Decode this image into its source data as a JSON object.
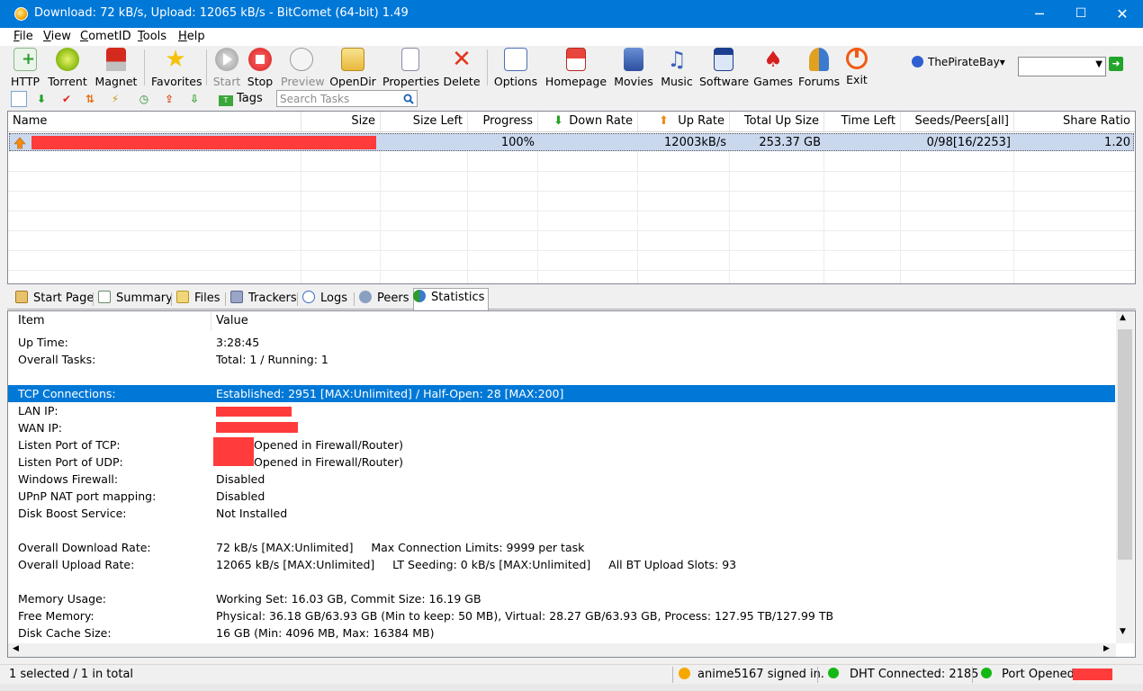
{
  "window": {
    "title": "Download: 72 kB/s, Upload: 12065 kB/s - BitComet (64-bit) 1.49",
    "minimize": "─",
    "maximize": "☐",
    "close": "✕"
  },
  "menu": [
    {
      "label": "File",
      "underline": "F",
      "rest": "ile"
    },
    {
      "label": "View",
      "underline": "V",
      "rest": "iew"
    },
    {
      "label": "CometID",
      "underline": "C",
      "rest": "ometID"
    },
    {
      "label": "Tools",
      "underline": "T",
      "rest": "ools"
    },
    {
      "label": "Help",
      "underline": "H",
      "rest": "elp"
    }
  ],
  "toolbar": {
    "http": "HTTP",
    "torrent": "Torrent",
    "magnet": "Magnet",
    "favorites": "Favorites",
    "start": "Start",
    "stop": "Stop",
    "preview": "Preview",
    "opendir": "OpenDir",
    "properties": "Properties",
    "delete": "Delete",
    "options": "Options",
    "homepage": "Homepage",
    "movies": "Movies",
    "music": "Music",
    "software": "Software",
    "games": "Games",
    "forums": "Forums",
    "exit": "Exit",
    "site": "ThePirateBay",
    "site_caret": "▾"
  },
  "toolbar2": {
    "tags": "Tags",
    "search_placeholder": "Search Tasks"
  },
  "tasklist": {
    "headers": {
      "name": "Name",
      "size": "Size",
      "size_left": "Size Left",
      "progress": "Progress",
      "down_rate": "Down Rate",
      "up_rate": "Up Rate",
      "total_up": "Total Up Size",
      "time_left": "Time Left",
      "seeds_peers": "Seeds/Peers[all]",
      "share_ratio": "Share Ratio"
    },
    "rows": [
      {
        "progress": "100%",
        "up_rate": "12003kB/s",
        "total_up": "253.37 GB",
        "seeds_peers": "0/98[16/2253]",
        "share_ratio": "1.20"
      }
    ]
  },
  "tabs": {
    "start_page": "Start Page",
    "summary": "Summary",
    "files": "Files",
    "trackers": "Trackers",
    "logs": "Logs",
    "peers": "Peers",
    "statistics": "Statistics"
  },
  "statistics": {
    "header_item": "Item",
    "header_value": "Value",
    "rows": [
      {
        "k": "Up Time:",
        "v": "3:28:45"
      },
      {
        "k": "Overall Tasks:",
        "v": "Total: 1 / Running: 1"
      },
      {
        "k": "TCP Connections:",
        "v": "Established: 2951 [MAX:Unlimited] / Half-Open: 28 [MAX:200]"
      },
      {
        "k": "LAN IP:",
        "v": ""
      },
      {
        "k": "WAN IP:",
        "v": ""
      },
      {
        "k": "Listen Port of TCP:",
        "v": "Opened in Firewall/Router)"
      },
      {
        "k": "Listen Port of UDP:",
        "v": "Opened in Firewall/Router)"
      },
      {
        "k": "Windows Firewall:",
        "v": "Disabled"
      },
      {
        "k": "UPnP NAT port mapping:",
        "v": "Disabled"
      },
      {
        "k": "Disk Boost Service:",
        "v": "Not Installed"
      },
      {
        "k": "Overall Download Rate:",
        "v": "72 kB/s [MAX:Unlimited]     Max Connection Limits: 9999 per task"
      },
      {
        "k": "Overall Upload Rate:",
        "v": "12065 kB/s [MAX:Unlimited]     LT Seeding: 0 kB/s [MAX:Unlimited]     All BT Upload Slots: 93"
      },
      {
        "k": "Memory Usage:",
        "v": "Working Set: 16.03 GB, Commit Size: 16.19 GB"
      },
      {
        "k": "Free Memory:",
        "v": "Physical: 36.18 GB/63.93 GB (Min to keep: 50 MB), Virtual: 28.27 GB/63.93 GB, Process: 127.95 TB/127.99 TB"
      },
      {
        "k": "Disk Cache Size:",
        "v": "16 GB (Min: 4096 MB, Max: 16384 MB)"
      }
    ]
  },
  "statusbar": {
    "selection": "1 selected / 1 in total",
    "user": "anime5167 signed in.",
    "dht": "DHT Connected: 2185",
    "port": "Port Opened:"
  },
  "colors": {
    "titlebar": "#0078d7",
    "selection": "#0078d7",
    "task_row": "#cad8ee",
    "redaction": "#ff3b3b",
    "ok_dot": "#14b814"
  }
}
